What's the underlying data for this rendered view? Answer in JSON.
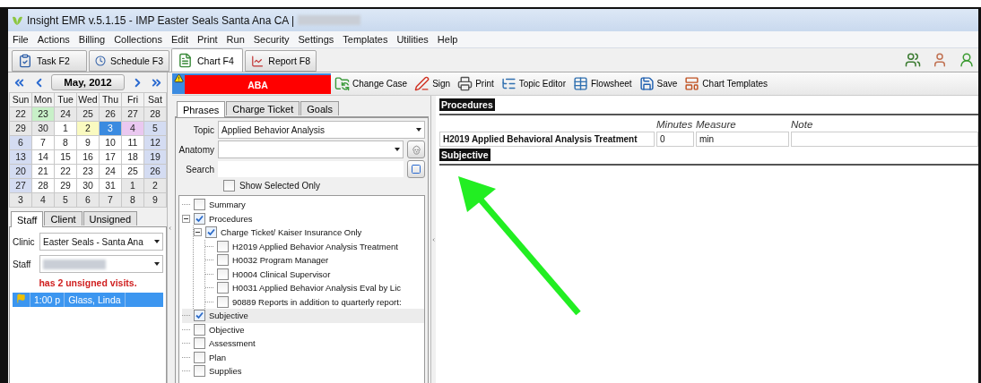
{
  "window": {
    "title": "Insight EMR v.5.1.15 - IMP Easter Seals Santa Ana CA |"
  },
  "menu": [
    "File",
    "Actions",
    "Billing",
    "Collections",
    "Edit",
    "Print",
    "Run",
    "Security",
    "Settings",
    "Templates",
    "Utilities",
    "Help"
  ],
  "nav_buttons": [
    {
      "label": "Task F2",
      "kind": "task"
    },
    {
      "label": "Schedule F3",
      "kind": "schedule"
    }
  ],
  "tabs": [
    {
      "label": "Chart F4",
      "kind": "chart",
      "selected": true
    },
    {
      "label": "Report F8",
      "kind": "report",
      "selected": false
    }
  ],
  "calendar": {
    "month": "May, 2012",
    "weekdays": [
      "Sun",
      "Mon",
      "Tue",
      "Wed",
      "Thu",
      "Fri",
      "Sat"
    ],
    "weeks": [
      [
        {
          "day": "22",
          "kind": "other",
          "selected": false
        },
        {
          "day": "23",
          "kind": "other",
          "selected": false,
          "color": "#c8f0c8"
        },
        {
          "day": "24",
          "kind": "other",
          "selected": false
        },
        {
          "day": "25",
          "kind": "other",
          "selected": false
        },
        {
          "day": "26",
          "kind": "other",
          "selected": false
        },
        {
          "day": "27",
          "kind": "other",
          "selected": false
        },
        {
          "day": "28",
          "kind": "other",
          "selected": false
        }
      ],
      [
        {
          "day": "29",
          "kind": "other",
          "selected": false
        },
        {
          "day": "30",
          "kind": "other",
          "selected": false
        },
        {
          "day": "1",
          "kind": "plain",
          "selected": false
        },
        {
          "day": "2",
          "kind": "plain",
          "selected": false,
          "color": "#fafac0"
        },
        {
          "day": "3",
          "kind": "plain",
          "selected": true
        },
        {
          "day": "4",
          "kind": "plain",
          "selected": false,
          "color": "#eac8f0"
        },
        {
          "day": "5",
          "kind": "weekend",
          "selected": false
        }
      ],
      [
        {
          "day": "6",
          "kind": "weekend",
          "selected": false
        },
        {
          "day": "7",
          "kind": "plain",
          "selected": false
        },
        {
          "day": "8",
          "kind": "plain",
          "selected": false
        },
        {
          "day": "9",
          "kind": "plain",
          "selected": false
        },
        {
          "day": "10",
          "kind": "plain",
          "selected": false
        },
        {
          "day": "11",
          "kind": "plain",
          "selected": false
        },
        {
          "day": "12",
          "kind": "weekend",
          "selected": false
        }
      ],
      [
        {
          "day": "13",
          "kind": "weekend",
          "selected": false
        },
        {
          "day": "14",
          "kind": "plain",
          "selected": false
        },
        {
          "day": "15",
          "kind": "plain",
          "selected": false
        },
        {
          "day": "16",
          "kind": "plain",
          "selected": false
        },
        {
          "day": "17",
          "kind": "plain",
          "selected": false
        },
        {
          "day": "18",
          "kind": "plain",
          "selected": false
        },
        {
          "day": "19",
          "kind": "weekend",
          "selected": false
        }
      ],
      [
        {
          "day": "20",
          "kind": "weekend",
          "selected": false
        },
        {
          "day": "21",
          "kind": "plain",
          "selected": false
        },
        {
          "day": "22",
          "kind": "plain",
          "selected": false
        },
        {
          "day": "23",
          "kind": "plain",
          "selected": false
        },
        {
          "day": "24",
          "kind": "plain",
          "selected": false
        },
        {
          "day": "25",
          "kind": "plain",
          "selected": false
        },
        {
          "day": "26",
          "kind": "weekend",
          "selected": false
        }
      ],
      [
        {
          "day": "27",
          "kind": "weekend",
          "selected": false
        },
        {
          "day": "28",
          "kind": "plain",
          "selected": false
        },
        {
          "day": "29",
          "kind": "plain",
          "selected": false
        },
        {
          "day": "30",
          "kind": "plain",
          "selected": false
        },
        {
          "day": "31",
          "kind": "plain",
          "selected": false
        },
        {
          "day": "1",
          "kind": "other",
          "selected": false
        },
        {
          "day": "2",
          "kind": "other",
          "selected": false
        }
      ],
      [
        {
          "day": "3",
          "kind": "other",
          "selected": false
        },
        {
          "day": "4",
          "kind": "other",
          "selected": false
        },
        {
          "day": "5",
          "kind": "other",
          "selected": false
        },
        {
          "day": "6",
          "kind": "other",
          "selected": false
        },
        {
          "day": "7",
          "kind": "other",
          "selected": false
        },
        {
          "day": "8",
          "kind": "other",
          "selected": false
        },
        {
          "day": "9",
          "kind": "other",
          "selected": false
        }
      ]
    ]
  },
  "staff_panel": {
    "tabs": [
      {
        "label": "Staff",
        "selected": true
      },
      {
        "label": "Client",
        "selected": false
      },
      {
        "label": "Unsigned",
        "selected": false
      }
    ],
    "clinic": {
      "label": "Clinic",
      "value": "Easter Seals - Santa Ana"
    },
    "staff": {
      "label": "Staff"
    },
    "notice": "has 2 unsigned visits.",
    "appointments": [
      {
        "time": "1:00 p",
        "name": "Glass, Linda",
        "selected": true
      }
    ]
  },
  "case": {
    "name": "ABA"
  },
  "toolbar": [
    {
      "label": "Change Case",
      "kind": "case"
    },
    {
      "label": "Sign",
      "kind": "sign"
    },
    {
      "label": "Print",
      "kind": "print"
    },
    {
      "label": "Topic Editor",
      "kind": "topic"
    },
    {
      "label": "Flowsheet",
      "kind": "flowsheet"
    },
    {
      "label": "Save",
      "kind": "save"
    },
    {
      "label": "Chart Templates",
      "kind": "templates"
    }
  ],
  "phrases": {
    "tabs": [
      {
        "label": "Phrases",
        "selected": true
      },
      {
        "label": "Charge Ticket",
        "selected": false
      },
      {
        "label": "Goals",
        "selected": false
      }
    ],
    "topic": {
      "label": "Topic",
      "value": "Applied Behavior Analysis"
    },
    "anatomy": {
      "label": "Anatomy"
    },
    "search": {
      "label": "Search"
    },
    "show_selected_only": {
      "label": "Show Selected Only",
      "checked": false
    },
    "tree": [
      {
        "label": "Summary",
        "checked": false,
        "selected": false
      },
      {
        "label": "Procedures",
        "checked": true,
        "selected": false,
        "expanded": true,
        "children": [
          {
            "label": "Charge Ticket/ Kaiser Insurance Only",
            "checked": true,
            "selected": false,
            "expanded": true,
            "children": [
              {
                "label": "H2019 Applied Behavior Analysis Treatment",
                "checked": false,
                "selected": false
              },
              {
                "label": "H0032 Program Manager",
                "checked": false,
                "selected": false
              },
              {
                "label": "H0004 Clinical Supervisor",
                "checked": false,
                "selected": false
              },
              {
                "label": "H0031 Applied Behavior Analysis Eval by Lic",
                "checked": false,
                "selected": false
              },
              {
                "label": "90889 Reports in addition to quarterly report:",
                "checked": false,
                "selected": false
              }
            ]
          }
        ]
      },
      {
        "label": "Subjective",
        "checked": true,
        "selected": true
      },
      {
        "label": "Objective",
        "checked": false,
        "selected": false
      },
      {
        "label": "Assessment",
        "checked": false,
        "selected": false
      },
      {
        "label": "Plan",
        "checked": false,
        "selected": false
      },
      {
        "label": "Supplies",
        "checked": false,
        "selected": false
      }
    ]
  },
  "note": {
    "sections": [
      {
        "title": "Procedures",
        "columns": [
          "Minutes",
          "Measure",
          "Note"
        ],
        "rows": [
          {
            "name": "H2019 Applied Behavioral Analysis Treatment",
            "minutes": "0",
            "measure": "min"
          }
        ]
      },
      {
        "title": "Subjective"
      }
    ]
  }
}
